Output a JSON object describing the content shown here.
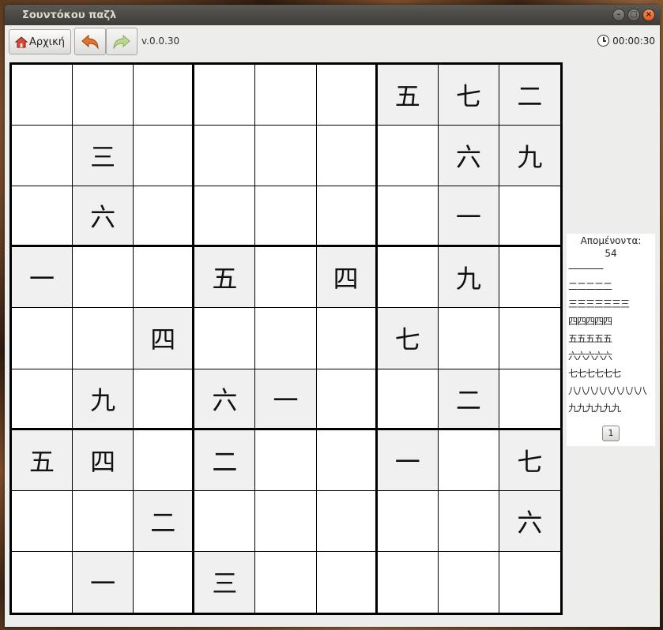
{
  "window": {
    "title": "Σουντόκου παζλ"
  },
  "toolbar": {
    "home_label": "Αρχική",
    "version": "v.0.0.30",
    "timer": "00:00:30"
  },
  "grid": [
    [
      "",
      "",
      "",
      "",
      "",
      "",
      "五",
      "七",
      "二"
    ],
    [
      "",
      "三",
      "",
      "",
      "",
      "",
      "",
      "六",
      "九"
    ],
    [
      "",
      "六",
      "",
      "",
      "",
      "",
      "",
      "一",
      ""
    ],
    [
      "一",
      "",
      "",
      "五",
      "",
      "四",
      "",
      "九",
      ""
    ],
    [
      "",
      "",
      "四",
      "",
      "",
      "",
      "七",
      "",
      ""
    ],
    [
      "",
      "九",
      "",
      "六",
      "一",
      "",
      "",
      "二",
      ""
    ],
    [
      "五",
      "四",
      "",
      "二",
      "",
      "",
      "一",
      "",
      "七"
    ],
    [
      "",
      "",
      "二",
      "",
      "",
      "",
      "",
      "",
      "六"
    ],
    [
      "",
      "一",
      "",
      "三",
      "",
      "",
      "",
      "",
      ""
    ]
  ],
  "side_panel": {
    "title": "Απομένοντα:",
    "count": "54",
    "rows": [
      "一一一一",
      "二二二二二",
      "三三三三三三三",
      "四四四四四",
      "五五五五五",
      "六六六六六",
      "七七七七七七",
      "八八八八八八八八八",
      "九九九九九九"
    ],
    "hint_label": "1"
  },
  "colors": {
    "given_cell": "#f0f0f0",
    "empty_cell": "#ffffff",
    "titlebar": "#3d3c38"
  }
}
